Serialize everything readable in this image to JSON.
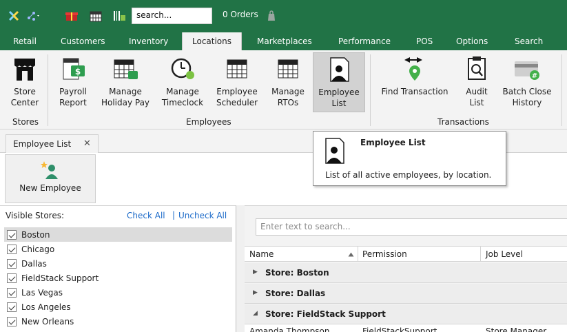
{
  "titlebar": {
    "search_value": "search...",
    "orders_label": "0 Orders"
  },
  "tabs": [
    "Retail",
    "Customers",
    "Inventory",
    "Locations",
    "Marketplaces",
    "Performance",
    "POS",
    "Options",
    "Search"
  ],
  "active_tab": "Locations",
  "ribbon": {
    "groups": [
      {
        "label": "Stores"
      },
      {
        "label": "Employees"
      },
      {
        "label": "Transactions"
      }
    ],
    "buttons": [
      {
        "label": "Store\nCenter"
      },
      {
        "label": "Payroll\nReport"
      },
      {
        "label": "Manage\nHoliday Pay"
      },
      {
        "label": "Manage\nTimeclock"
      },
      {
        "label": "Employee\nScheduler"
      },
      {
        "label": "Manage\nRTOs"
      },
      {
        "label": "Employee\nList"
      },
      {
        "label": "Find Transaction"
      },
      {
        "label": "Audit\nList"
      },
      {
        "label": "Batch Close\nHistory"
      }
    ],
    "selected_button": "Employee List"
  },
  "tooltip": {
    "title": "Employee List",
    "description": "List of all active employees, by location."
  },
  "doc_tab": {
    "label": "Employee List",
    "close": "✕"
  },
  "toolbar": {
    "new_employee_label": "New Employee"
  },
  "stores_panel": {
    "heading": "Visible Stores:",
    "check_all": "Check All",
    "separator": "|",
    "uncheck_all": "Uncheck All",
    "stores": [
      "Boston",
      "Chicago",
      "Dallas",
      "FieldStack Support",
      "Las Vegas",
      "Los Angeles",
      "New Orleans"
    ],
    "selected_store": "Boston"
  },
  "grid": {
    "search_placeholder": "Enter text to search...",
    "columns": [
      "Name",
      "Permission",
      "Job Level"
    ],
    "groups": [
      {
        "label": "Store: Boston",
        "expanded": false
      },
      {
        "label": "Store: Dallas",
        "expanded": false
      },
      {
        "label": "Store: FieldStack Support",
        "expanded": true
      }
    ],
    "rows": [
      {
        "name": "Amanda Thompson",
        "permission": "FieldStackSupport",
        "job_level": "Store Manager"
      }
    ]
  },
  "colors": {
    "brand_green": "#217346",
    "link_blue": "#1b6ac9",
    "ribbon_bg": "#f3f3f3"
  }
}
